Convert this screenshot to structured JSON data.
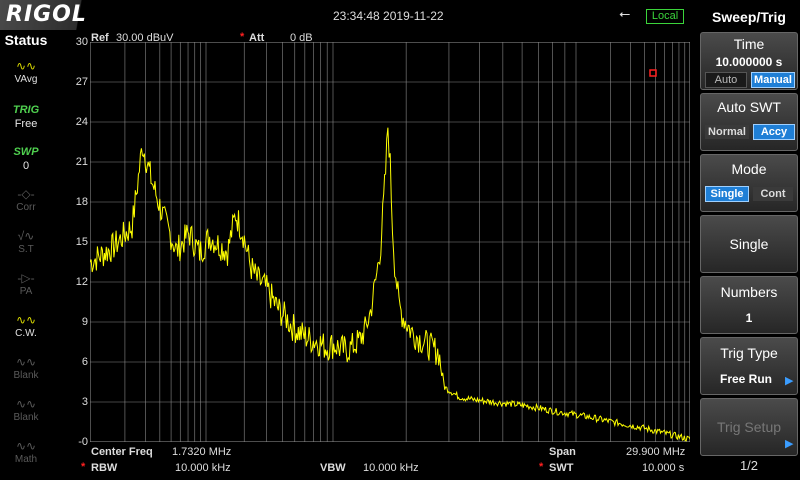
{
  "brand": "RIGOL",
  "datetime": "23:34:48 2019-11-22",
  "remote_status": "Local",
  "status_panel": {
    "title": "Status",
    "items": [
      {
        "icon": "vavg-icon",
        "label": "VAvg",
        "state": "active"
      },
      {
        "icon": "trig-text",
        "label": "Free",
        "tag": "TRIG",
        "state": "trig"
      },
      {
        "icon": "swp-text",
        "label": "0",
        "tag": "SWP",
        "state": "trig"
      },
      {
        "icon": "corr-icon",
        "label": "Corr",
        "state": "dim"
      },
      {
        "icon": "st-icon",
        "label": "S.T",
        "state": "dim"
      },
      {
        "icon": "pa-icon",
        "label": "PA",
        "state": "dim"
      },
      {
        "icon": "cw-icon",
        "label": "C.W.",
        "state": "active"
      },
      {
        "icon": "blank-icon",
        "label": "Blank",
        "state": "dim"
      },
      {
        "icon": "blank-icon",
        "label": "Blank",
        "state": "dim"
      },
      {
        "icon": "math-icon",
        "label": "Math",
        "state": "dim"
      }
    ]
  },
  "header": {
    "ref_label": "Ref",
    "ref_value": "30.00 dBuV",
    "att_label": "Att",
    "att_value": "0 dB"
  },
  "footer": {
    "center_label": "Center Freq",
    "center_value": "1.7320 MHz",
    "span_label": "Span",
    "span_value": "29.900 MHz",
    "rbw_label": "RBW",
    "rbw_value": "10.000 kHz",
    "vbw_label": "VBW",
    "vbw_value": "10.000 kHz",
    "swt_label": "SWT",
    "swt_value": "10.000 s"
  },
  "menu": {
    "title": "Sweep/Trig",
    "time_label": "Time",
    "time_value": "10.000000 s",
    "time_auto": "Auto",
    "time_manual": "Manual",
    "auto_swt_label": "Auto SWT",
    "auto_swt_normal": "Normal",
    "auto_swt_accy": "Accy",
    "mode_label": "Mode",
    "mode_single": "Single",
    "mode_cont": "Cont",
    "single_label": "Single",
    "numbers_label": "Numbers",
    "numbers_value": "1",
    "trig_type_label": "Trig Type",
    "trig_type_value": "Free Run",
    "trig_setup_label": "Trig Setup",
    "page": "1/2"
  },
  "colors": {
    "trace": "#ffff00",
    "grid": "#8a8a8a",
    "accent": "#1f7fd6",
    "local": "#3bd43b"
  },
  "chart_data": {
    "type": "line",
    "ylim": [
      0,
      30
    ],
    "yticks": [
      "30",
      "27",
      "24",
      "21",
      "18",
      "15",
      "12",
      "9",
      "6",
      "3",
      "-0"
    ],
    "x_unit": "MHz",
    "x_start": 0,
    "x_end": 29.9,
    "x_scale": "log",
    "series": [
      {
        "points": [
          [
            0,
            13.5
          ],
          [
            0.05,
            14.6
          ],
          [
            0.1,
            16.2
          ],
          [
            0.13,
            22.3
          ],
          [
            0.16,
            19.5
          ],
          [
            0.2,
            16.8
          ],
          [
            0.25,
            14.3
          ],
          [
            0.3,
            15.7
          ],
          [
            0.35,
            14.2
          ],
          [
            0.4,
            15.4
          ],
          [
            0.45,
            14.8
          ],
          [
            0.5,
            14.3
          ],
          [
            0.55,
            17.1
          ],
          [
            0.6,
            15.6
          ],
          [
            0.65,
            13.2
          ],
          [
            0.7,
            12.2
          ],
          [
            0.75,
            11.8
          ],
          [
            0.8,
            11.1
          ],
          [
            0.85,
            10.3
          ],
          [
            0.9,
            9.7
          ],
          [
            0.95,
            9.3
          ],
          [
            1.0,
            8.7
          ],
          [
            1.1,
            8.1
          ],
          [
            1.2,
            7.7
          ],
          [
            1.3,
            7.5
          ],
          [
            1.4,
            7.1
          ],
          [
            1.5,
            7.3
          ],
          [
            1.6,
            7.0
          ],
          [
            1.7,
            6.9
          ],
          [
            1.8,
            7.2
          ],
          [
            1.9,
            7.6
          ],
          [
            2.0,
            8.4
          ],
          [
            2.1,
            9.8
          ],
          [
            2.2,
            12.1
          ],
          [
            2.3,
            14.8
          ],
          [
            2.4,
            20.2
          ],
          [
            2.45,
            23.7
          ],
          [
            2.5,
            20.8
          ],
          [
            2.55,
            16.2
          ],
          [
            2.6,
            13.4
          ],
          [
            2.7,
            10.2
          ],
          [
            2.8,
            9.4
          ],
          [
            3.0,
            8.3
          ],
          [
            3.2,
            7.8
          ],
          [
            3.5,
            7.2
          ],
          [
            3.8,
            6.7
          ],
          [
            4.0,
            4.1
          ],
          [
            4.5,
            3.4
          ],
          [
            5.0,
            3.2
          ],
          [
            6,
            3.0
          ],
          [
            8,
            2.7
          ],
          [
            10,
            2.3
          ],
          [
            13,
            1.9
          ],
          [
            16,
            1.5
          ],
          [
            20,
            1.1
          ],
          [
            25,
            0.6
          ],
          [
            29.9,
            0.2
          ]
        ]
      }
    ],
    "grid": true,
    "legend": "none"
  }
}
